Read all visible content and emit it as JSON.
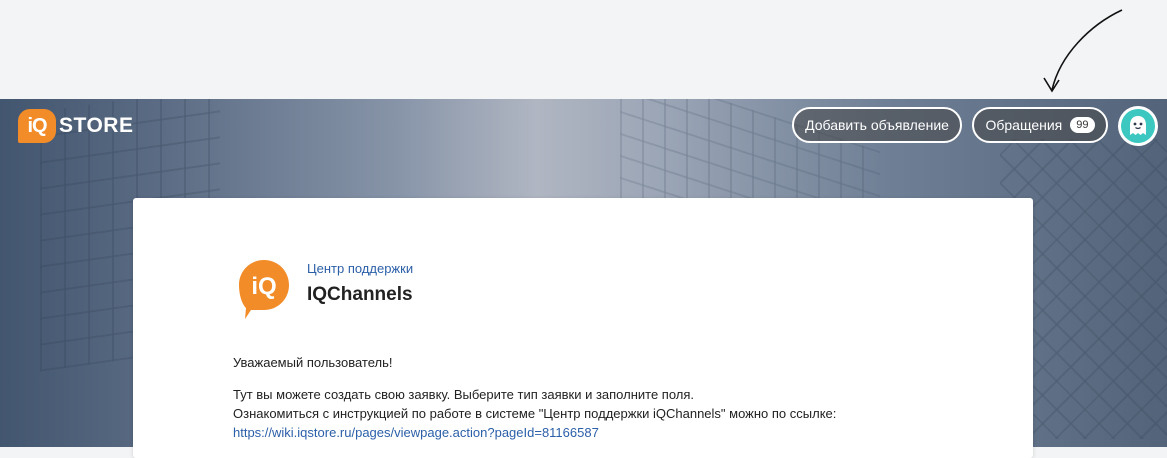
{
  "header": {
    "logo_text": "STORE",
    "logo_mark": "iQ",
    "add_listing_label": "Добавить объявление",
    "requests_label": "Обращения",
    "requests_count": "99"
  },
  "card": {
    "logo_mark": "iQ",
    "subtitle": "Центр поддержки",
    "title": "IQChannels",
    "greeting": "Уважаемый пользователь!",
    "line1": "Тут вы можете создать свою заявку. Выберите тип заявки и заполните поля.",
    "line2": "Ознакомиться с инструкцией по работе в системе \"Центр поддержки iQChannels\" можно по ссылке:",
    "link": "https://wiki.iqstore.ru/pages/viewpage.action?pageId=81166587"
  },
  "colors": {
    "brand_orange": "#f28c28",
    "link_blue": "#2b5fa8",
    "avatar_teal": "#3cc8c0"
  },
  "icons": {
    "avatar": "ghost-avatar-icon",
    "annotation": "arrow-annotation-icon"
  }
}
